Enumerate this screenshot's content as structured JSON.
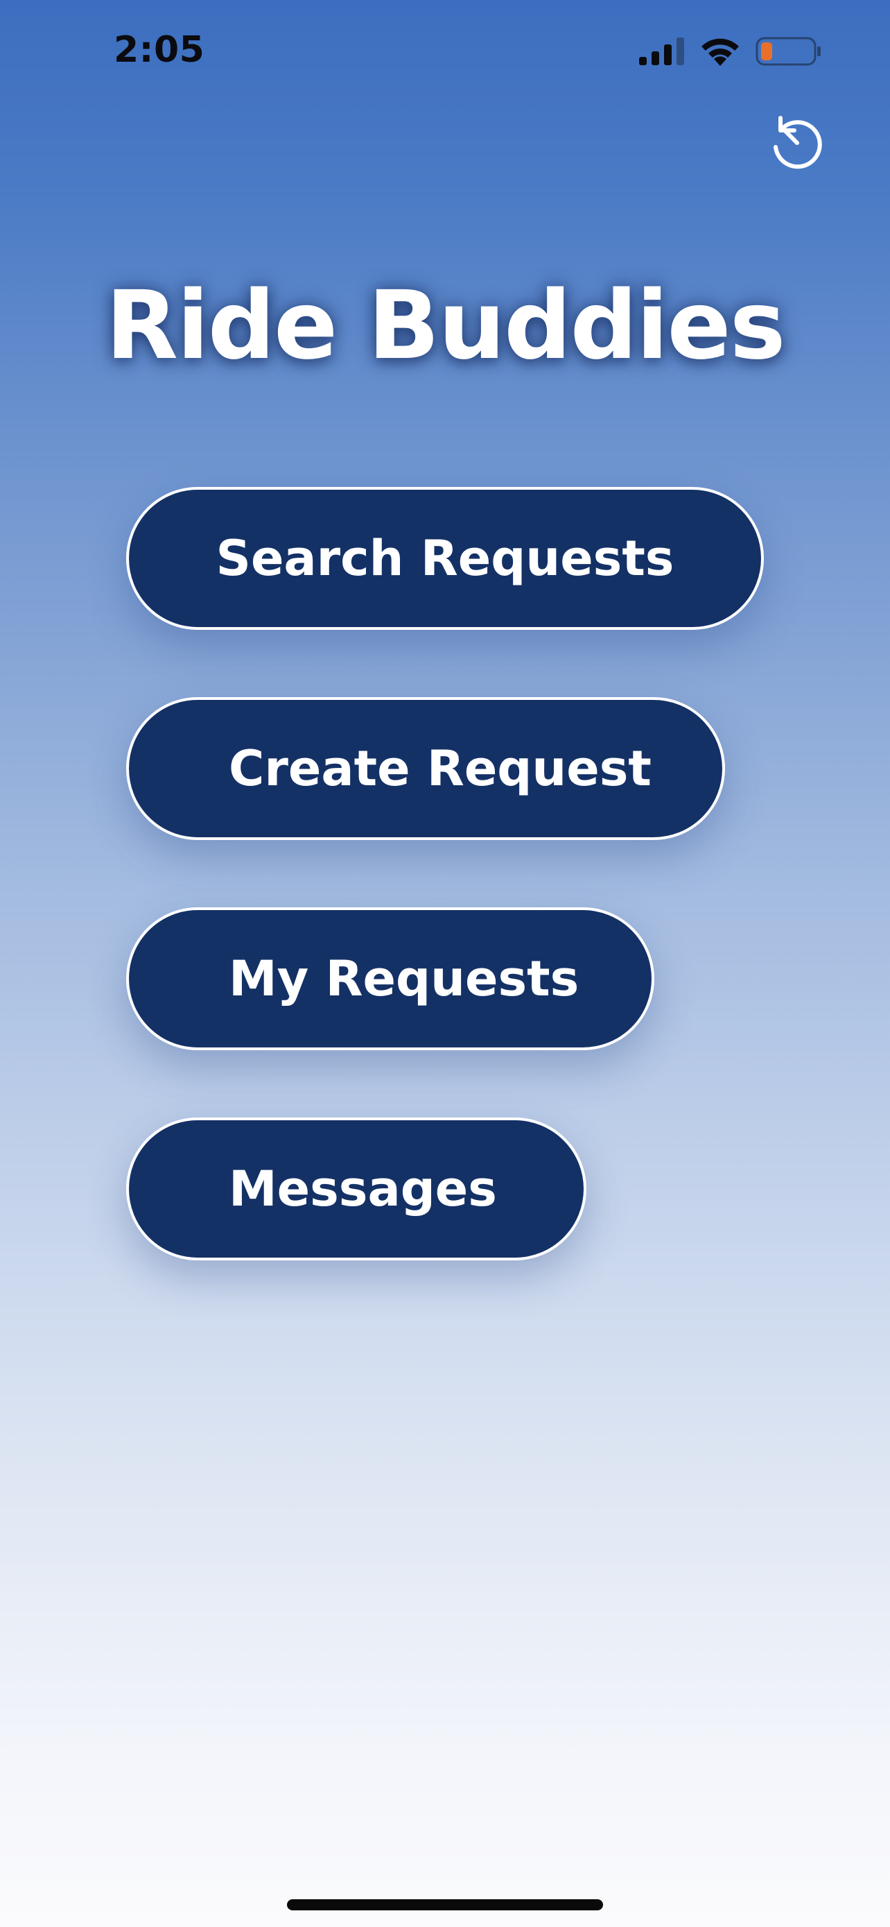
{
  "status_bar": {
    "time": "2:05",
    "signal_icon": "cellular-signal-icon",
    "wifi_icon": "wifi-icon",
    "battery_icon": "battery-low-icon",
    "battery_color": "#e8702a"
  },
  "header": {
    "refresh_icon": "refresh-icon"
  },
  "app": {
    "title": "Ride Buddies"
  },
  "menu": {
    "search_requests": "Search Requests",
    "create_request": "Create Request",
    "my_requests": "My Requests",
    "messages": "Messages"
  },
  "colors": {
    "button_fill": "#143166",
    "button_border": "#ffffff",
    "gradient_top": "#3c6ec0",
    "gradient_bottom": "#fbfbfd"
  }
}
